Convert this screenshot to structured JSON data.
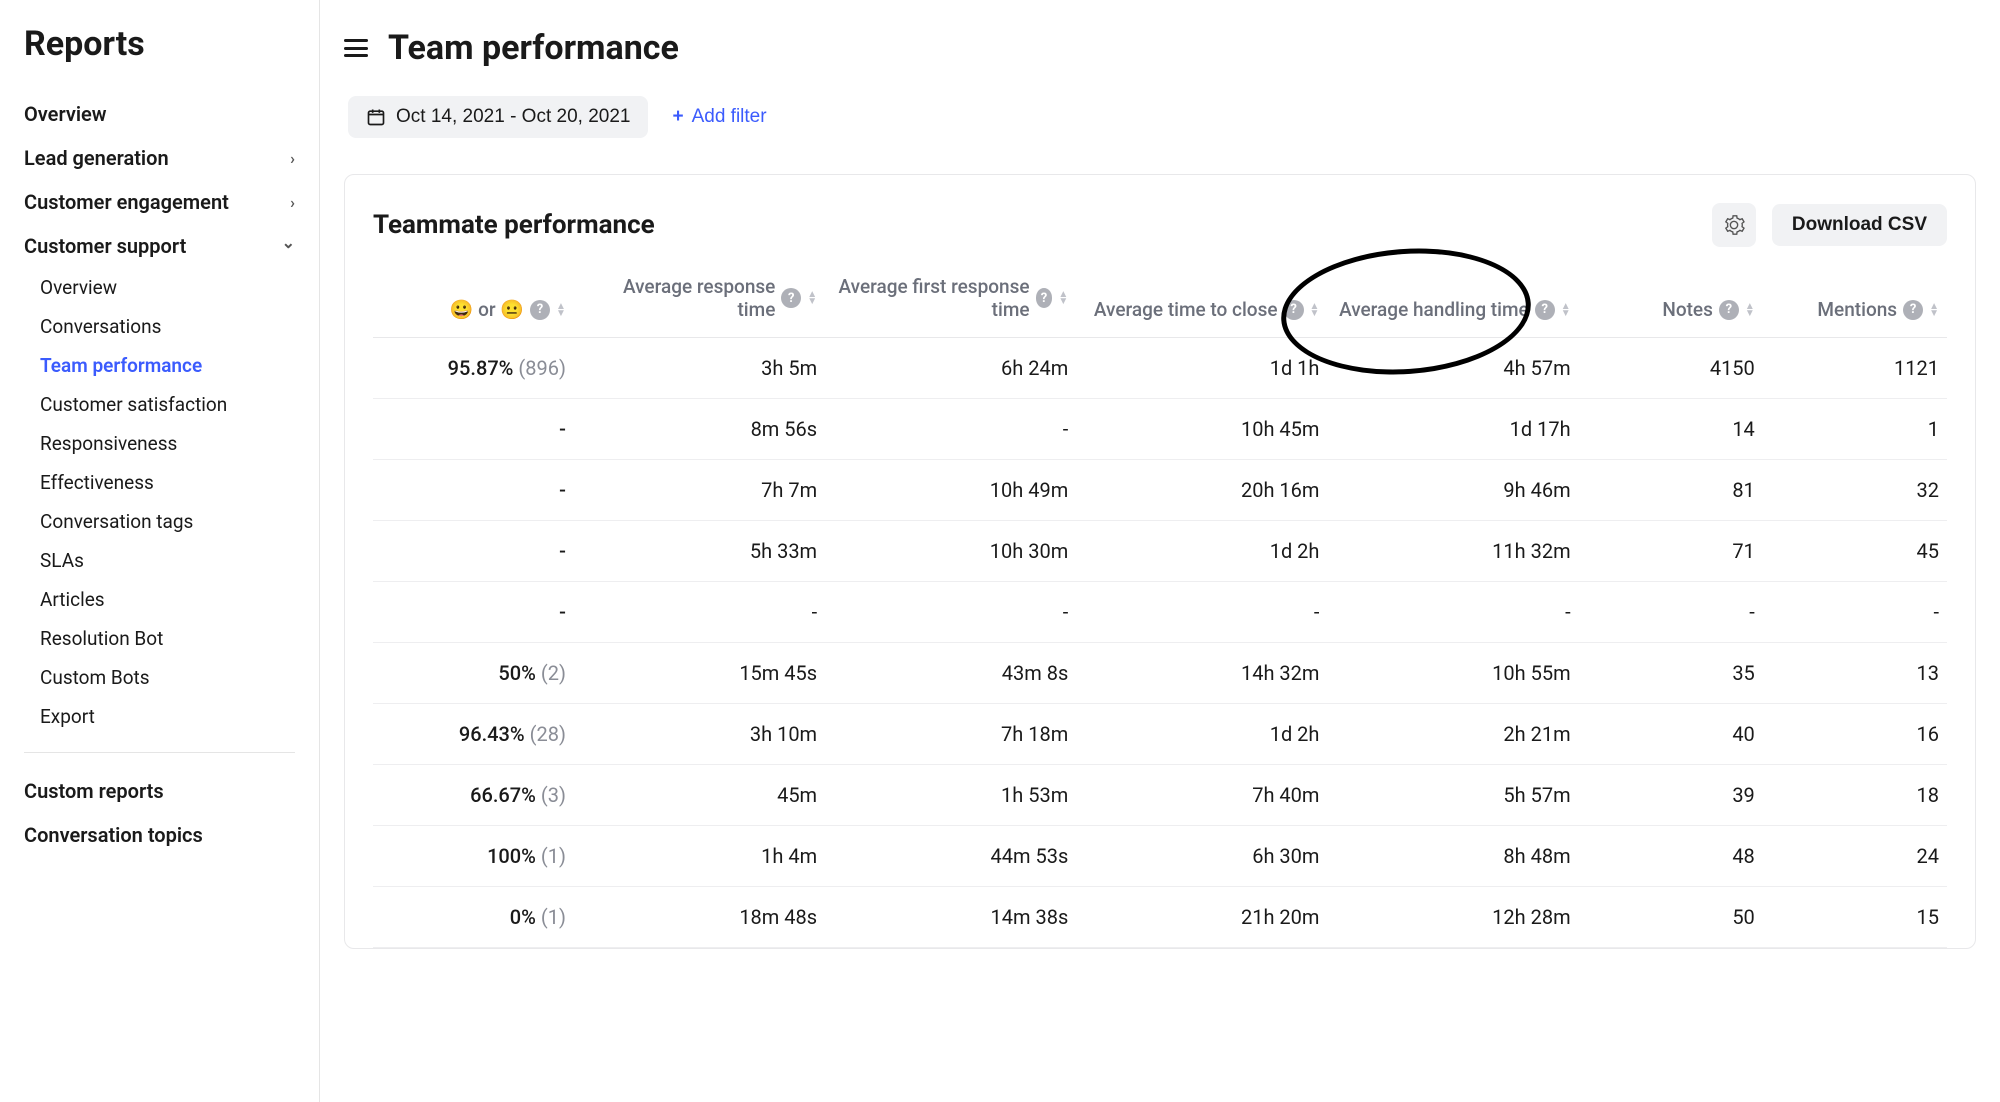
{
  "sidebar": {
    "title": "Reports",
    "items": [
      {
        "label": "Overview",
        "type": "top"
      },
      {
        "label": "Lead generation",
        "type": "top",
        "chevron": "right"
      },
      {
        "label": "Customer engagement",
        "type": "top",
        "chevron": "right"
      },
      {
        "label": "Customer support",
        "type": "top",
        "chevron": "down"
      },
      {
        "label": "Overview",
        "type": "sub"
      },
      {
        "label": "Conversations",
        "type": "sub"
      },
      {
        "label": "Team performance",
        "type": "sub",
        "active": true
      },
      {
        "label": "Customer satisfaction",
        "type": "sub"
      },
      {
        "label": "Responsiveness",
        "type": "sub"
      },
      {
        "label": "Effectiveness",
        "type": "sub"
      },
      {
        "label": "Conversation tags",
        "type": "sub"
      },
      {
        "label": "SLAs",
        "type": "sub"
      },
      {
        "label": "Articles",
        "type": "sub"
      },
      {
        "label": "Resolution Bot",
        "type": "sub"
      },
      {
        "label": "Custom Bots",
        "type": "sub"
      },
      {
        "label": "Export",
        "type": "sub"
      }
    ],
    "footer": [
      {
        "label": "Custom reports"
      },
      {
        "label": "Conversation topics"
      }
    ]
  },
  "header": {
    "title": "Team performance",
    "date_range": "Oct 14, 2021 - Oct 20, 2021",
    "add_filter_label": "Add filter"
  },
  "panel": {
    "title": "Teammate performance",
    "download_label": "Download CSV",
    "columns": [
      {
        "label": "😀 or 😐",
        "help": true,
        "sort": true
      },
      {
        "label": "Average response time",
        "help": true,
        "sort": true
      },
      {
        "label": "Average first response time",
        "help": true,
        "sort": true
      },
      {
        "label": "Average time to close",
        "help": true,
        "sort": true
      },
      {
        "label": "Average handling time",
        "help": true,
        "sort": true
      },
      {
        "label": "Notes",
        "help": true,
        "sort": true
      },
      {
        "label": "Mentions",
        "help": true,
        "sort": true
      }
    ],
    "annotated_column_index": 4,
    "rows": [
      {
        "csat_pct": "95.87%",
        "csat_count": "(896)",
        "resp": "3h 5m",
        "first_resp": "6h 24m",
        "close": "1d 1h",
        "handle": "4h 57m",
        "notes": "4150",
        "mentions": "1121"
      },
      {
        "csat_pct": "-",
        "csat_count": "",
        "resp": "8m 56s",
        "first_resp": "-",
        "close": "10h 45m",
        "handle": "1d 17h",
        "notes": "14",
        "mentions": "1"
      },
      {
        "csat_pct": "-",
        "csat_count": "",
        "resp": "7h 7m",
        "first_resp": "10h 49m",
        "close": "20h 16m",
        "handle": "9h 46m",
        "notes": "81",
        "mentions": "32"
      },
      {
        "csat_pct": "-",
        "csat_count": "",
        "resp": "5h 33m",
        "first_resp": "10h 30m",
        "close": "1d 2h",
        "handle": "11h 32m",
        "notes": "71",
        "mentions": "45"
      },
      {
        "csat_pct": "-",
        "csat_count": "",
        "resp": "-",
        "first_resp": "-",
        "close": "-",
        "handle": "-",
        "notes": "-",
        "mentions": "-"
      },
      {
        "csat_pct": "50%",
        "csat_count": "(2)",
        "resp": "15m 45s",
        "first_resp": "43m 8s",
        "close": "14h 32m",
        "handle": "10h 55m",
        "notes": "35",
        "mentions": "13"
      },
      {
        "csat_pct": "96.43%",
        "csat_count": "(28)",
        "resp": "3h 10m",
        "first_resp": "7h 18m",
        "close": "1d 2h",
        "handle": "2h 21m",
        "notes": "40",
        "mentions": "16"
      },
      {
        "csat_pct": "66.67%",
        "csat_count": "(3)",
        "resp": "45m",
        "first_resp": "1h 53m",
        "close": "7h 40m",
        "handle": "5h 57m",
        "notes": "39",
        "mentions": "18"
      },
      {
        "csat_pct": "100%",
        "csat_count": "(1)",
        "resp": "1h 4m",
        "first_resp": "44m 53s",
        "close": "6h 30m",
        "handle": "8h 48m",
        "notes": "48",
        "mentions": "24"
      },
      {
        "csat_pct": "0%",
        "csat_count": "(1)",
        "resp": "18m 48s",
        "first_resp": "14m 38s",
        "close": "21h 20m",
        "handle": "12h 28m",
        "notes": "50",
        "mentions": "15"
      }
    ]
  }
}
